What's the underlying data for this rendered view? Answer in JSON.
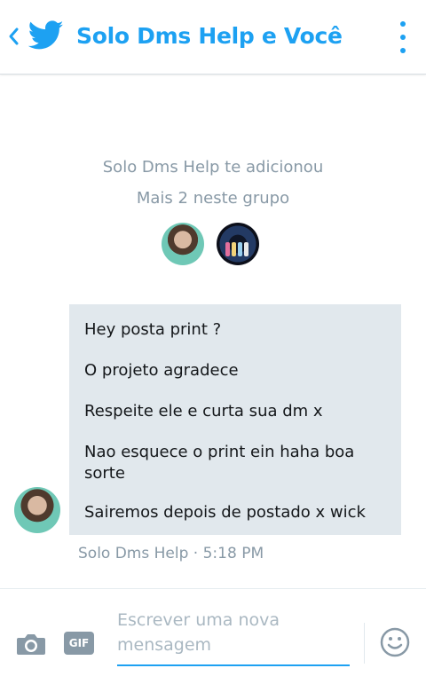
{
  "header": {
    "title": "Solo Dms Help e Você",
    "back_icon": "chevron-left-icon",
    "logo_icon": "twitter-bird-icon",
    "menu_icon": "more-vertical-icon"
  },
  "system": {
    "added_text": "Solo Dms Help te adicionou",
    "more_text": "Mais 2 neste grupo"
  },
  "messages": [
    "Hey posta print ?",
    "O projeto agradece",
    "Respeite ele e curta sua dm x",
    "Nao esquece o print ein haha boa sorte",
    "Sairemos depois de postado x wick"
  ],
  "meta": {
    "sender": "Solo Dms Help",
    "separator": "·",
    "time": "5:18 PM"
  },
  "composer": {
    "placeholder": "Escrever uma nova mensagem",
    "gif_label": "GIF",
    "camera_icon": "camera-icon",
    "emoji_icon": "emoji-icon"
  },
  "colors": {
    "accent": "#1da1f2",
    "bubble": "#e1e8ed",
    "muted": "#8899a6"
  }
}
